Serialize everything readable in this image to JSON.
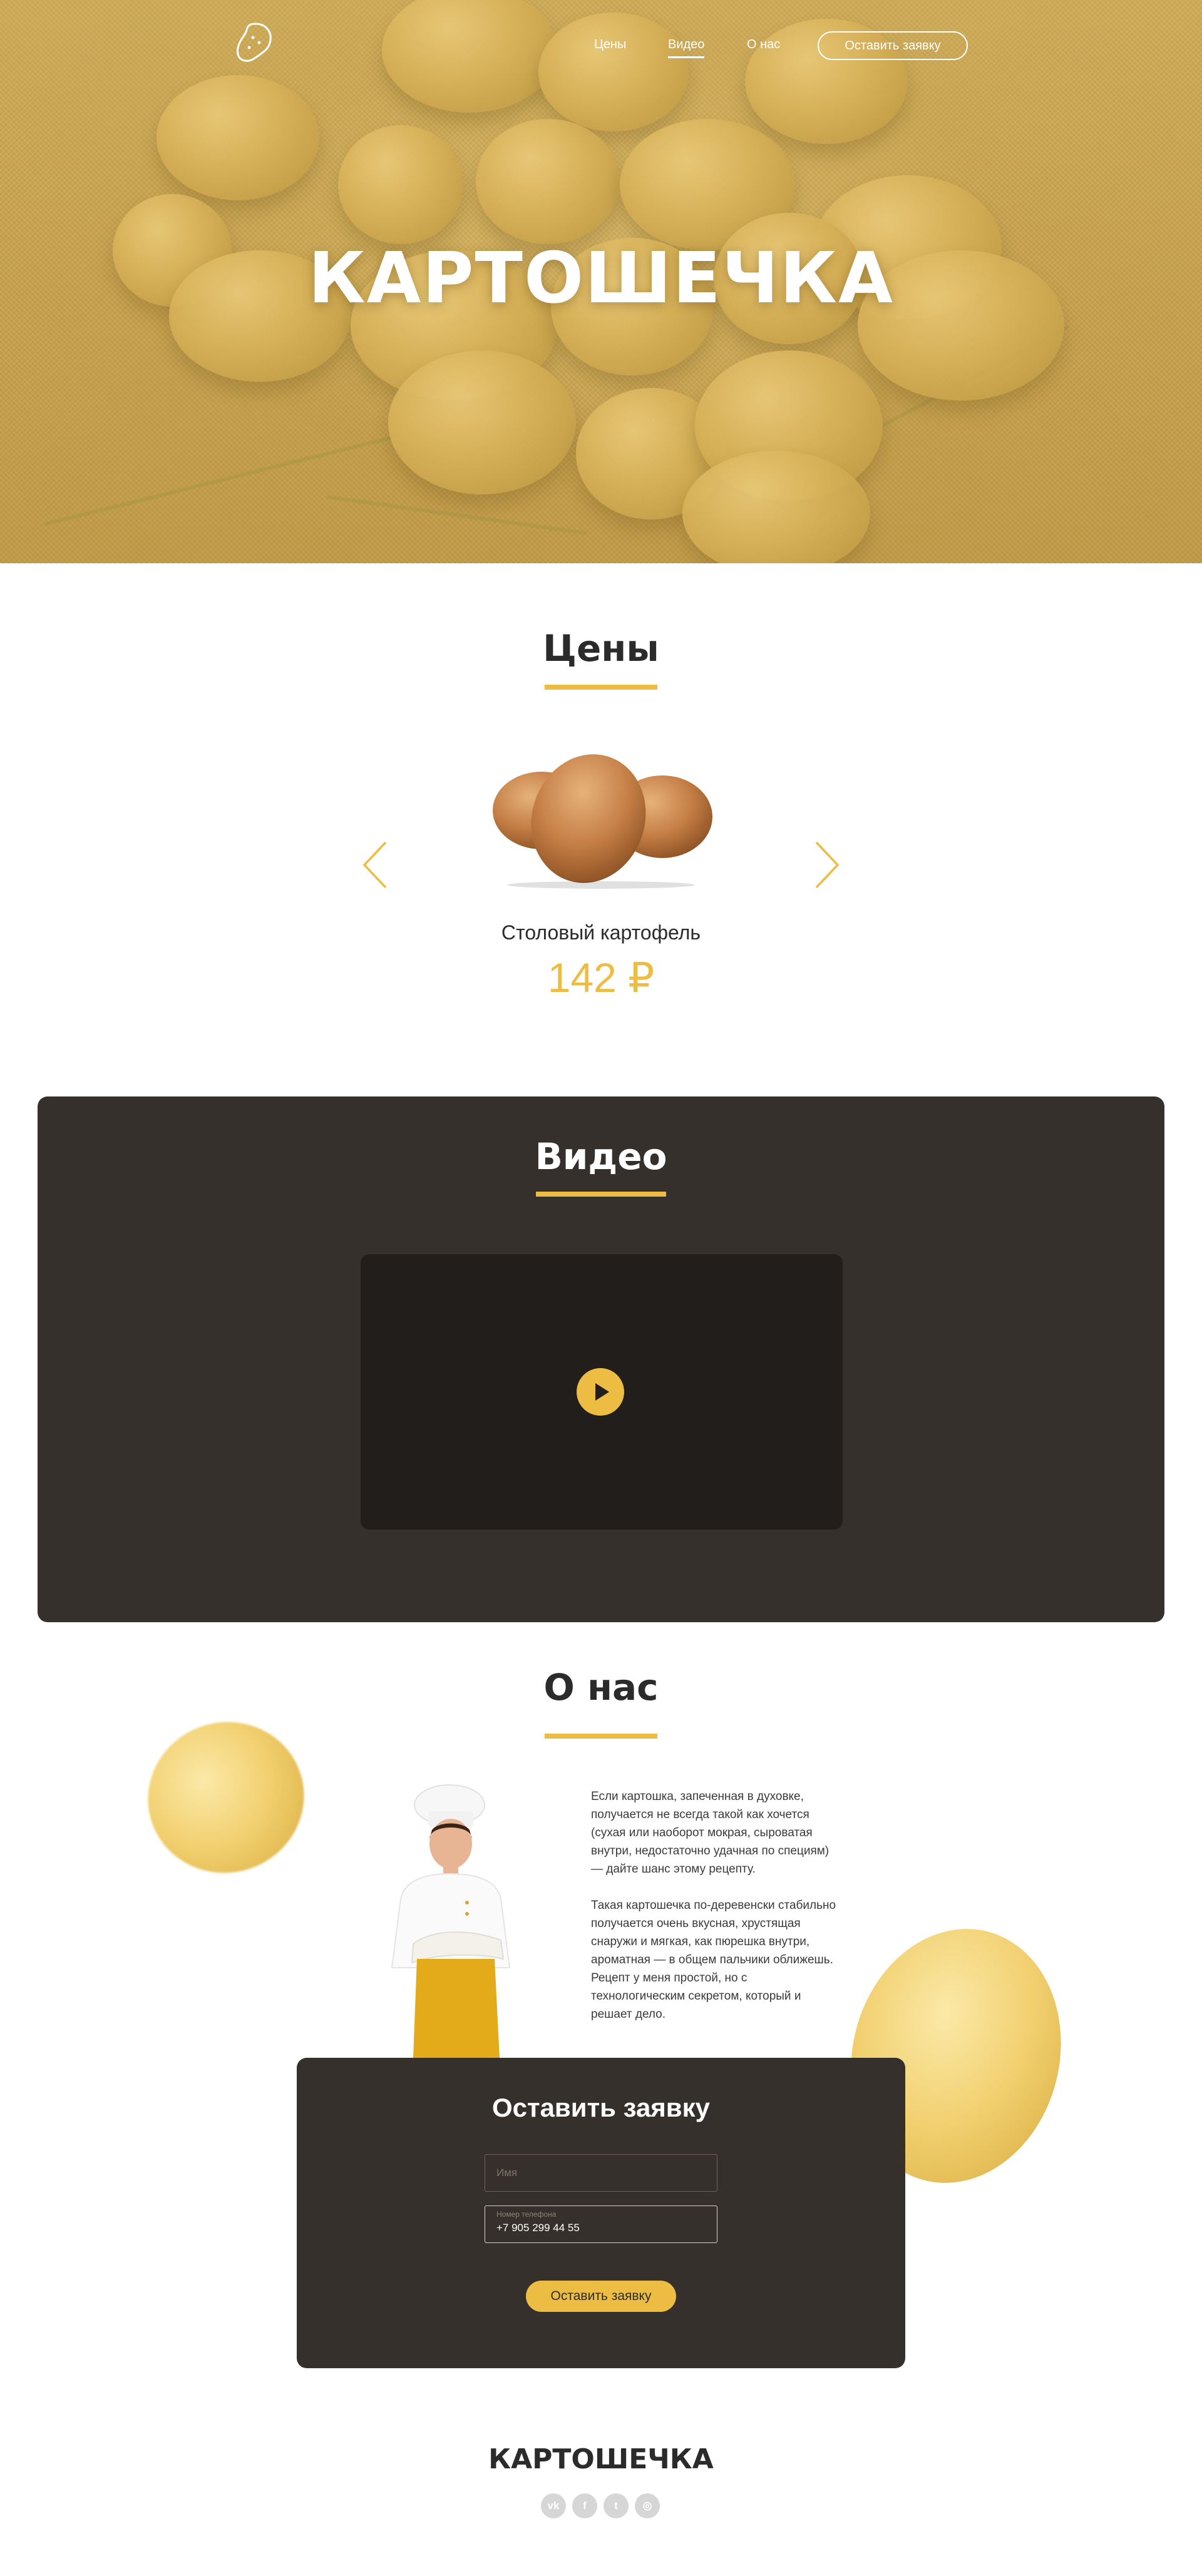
{
  "header": {
    "nav": [
      {
        "label": "Цены",
        "active": false
      },
      {
        "label": "Видео",
        "active": true
      },
      {
        "label": "О нас",
        "active": false
      }
    ],
    "cta_label": "Оставить заявку",
    "logo_icon": "potato-icon"
  },
  "hero": {
    "title": "КАРТОШЕЧКА"
  },
  "prices": {
    "title": "Цены",
    "product": {
      "name": "Столовый картофель",
      "price": "142 ₽"
    },
    "prev_icon": "chevron-left-icon",
    "next_icon": "chevron-right-icon"
  },
  "video": {
    "title": "Видео",
    "play_icon": "play-icon"
  },
  "about": {
    "title": "О нас",
    "paragraphs": [
      "Если картошка, запеченная в духовке, получается не всегда такой как хочется (сухая или наоборот мокрая, сыроватая внутри, недостаточно удачная по специям) — дайте шанс этому рецепту.",
      "Такая картошечка по-деревенски стабильно получается очень вкусная, хрустящая снаружи и мягкая, как пюрешка внутри, ароматная — в общем пальчики оближешь. Рецепт у меня простой, но с технологическим секретом, который и решает дело."
    ]
  },
  "form": {
    "title": "Оставить заявку",
    "name_placeholder": "Имя",
    "phone_label": "Номер телефона",
    "phone_value": "+7 905 299 44 55",
    "submit_label": "Оставить заявку"
  },
  "footer": {
    "logo": "КАРТОШЕЧКА",
    "social": [
      {
        "name": "vk-icon",
        "glyph": "vk"
      },
      {
        "name": "facebook-icon",
        "glyph": "f"
      },
      {
        "name": "twitter-icon",
        "glyph": "t"
      },
      {
        "name": "instagram-icon",
        "glyph": "◎"
      }
    ]
  },
  "colors": {
    "accent": "#edbd43",
    "dark": "#35302b",
    "text": "#2b2b2b"
  }
}
